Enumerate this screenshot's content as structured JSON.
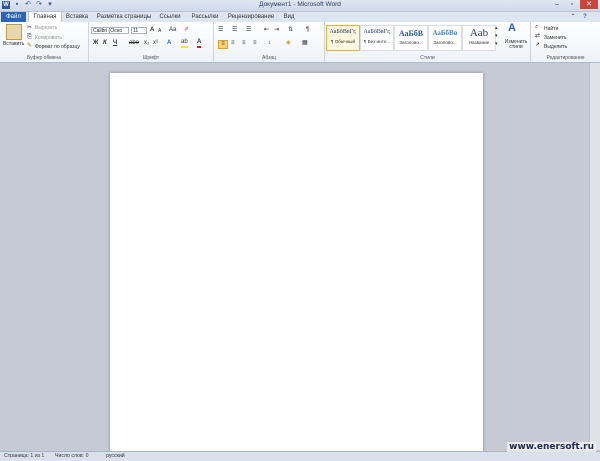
{
  "window": {
    "title": "Документ1 - Microsoft Word"
  },
  "tabs": [
    {
      "label": "Файл"
    },
    {
      "label": "Главная"
    },
    {
      "label": "Вставка"
    },
    {
      "label": "Разметка страницы"
    },
    {
      "label": "Ссылки"
    },
    {
      "label": "Рассылки"
    },
    {
      "label": "Рецензирование"
    },
    {
      "label": "Вид"
    }
  ],
  "clipboard": {
    "paste": "Вставить",
    "cut": "Вырезать",
    "copy": "Копировать",
    "format_painter": "Формат по образцу",
    "group": "Буфер обмена"
  },
  "font": {
    "name": "Calibri (Осно",
    "size": "11",
    "group": "Шрифт",
    "grow": "A",
    "shrink": "A",
    "case": "Aa",
    "bold": "Ж",
    "italic": "К",
    "underline": "Ч",
    "strike": "abe",
    "sub": "x₂",
    "sup": "x²",
    "highlight": "ab",
    "color": "A"
  },
  "paragraph": {
    "group": "Абзац",
    "pilcrow": "¶"
  },
  "styles": {
    "group": "Стили",
    "items": [
      {
        "preview": "АаБбВвГг,",
        "name": "¶ Обычный"
      },
      {
        "preview": "АаБбВвГг,",
        "name": "¶ Без инте..."
      },
      {
        "preview": "АаБбВ",
        "name": "Заголово..."
      },
      {
        "preview": "АаБбВв",
        "name": "Заголово..."
      },
      {
        "preview": "Aab",
        "name": "Название"
      }
    ],
    "change": "Изменить стили"
  },
  "editing": {
    "group": "Редактирование",
    "find": "Найти",
    "replace": "Заменить",
    "select": "Выделить"
  },
  "status": {
    "page": "Страница: 1 из 1",
    "words": "Число слов: 0",
    "lang": "русский"
  },
  "watermark": "www.enersoft.ru",
  "colors": {
    "file_tab": "#2a64b2",
    "highlight": "#f4e23a",
    "font_color": "#d02020"
  }
}
